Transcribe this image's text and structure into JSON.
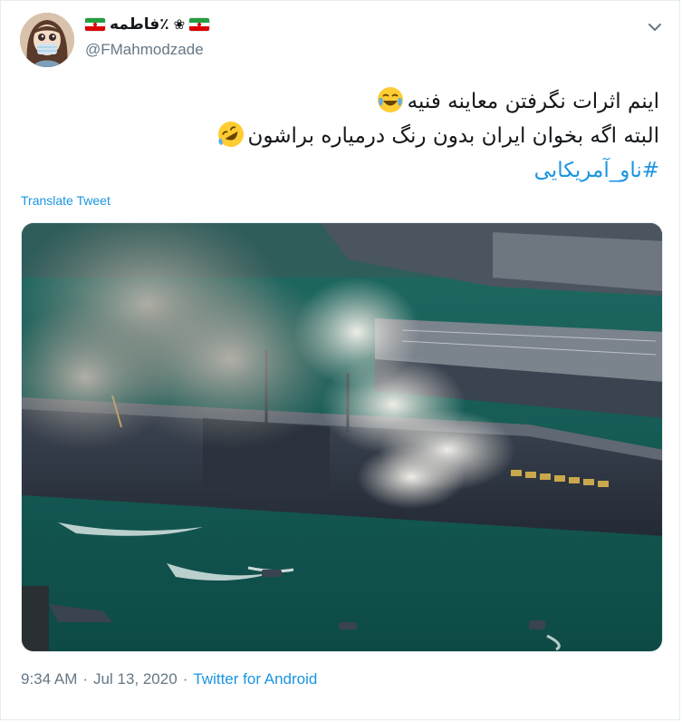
{
  "user": {
    "display_name": "٪فاطمه",
    "handle": "@FMahmodzade"
  },
  "tweet": {
    "lines": [
      "اینم اثرات نگرفتن معاینه فنیه",
      "البته اگه بخوان ایران بدون رنگ درمیاره براشون"
    ],
    "hashtag": "#ناو_آمریکایی",
    "emojis": [
      "joy-emoji",
      "rofl-emoji"
    ]
  },
  "translate_label": "Translate Tweet",
  "meta": {
    "time": "9:34 AM",
    "separator": "·",
    "date": "Jul 13, 2020",
    "source": "Twitter for Android"
  },
  "colors": {
    "link": "#1b95e0",
    "muted": "#657786",
    "text": "#14171a",
    "border": "#e6ecf0"
  },
  "icons": [
    "avatar",
    "iran-flag-icon",
    "flower-icon",
    "chevron-down-icon"
  ]
}
